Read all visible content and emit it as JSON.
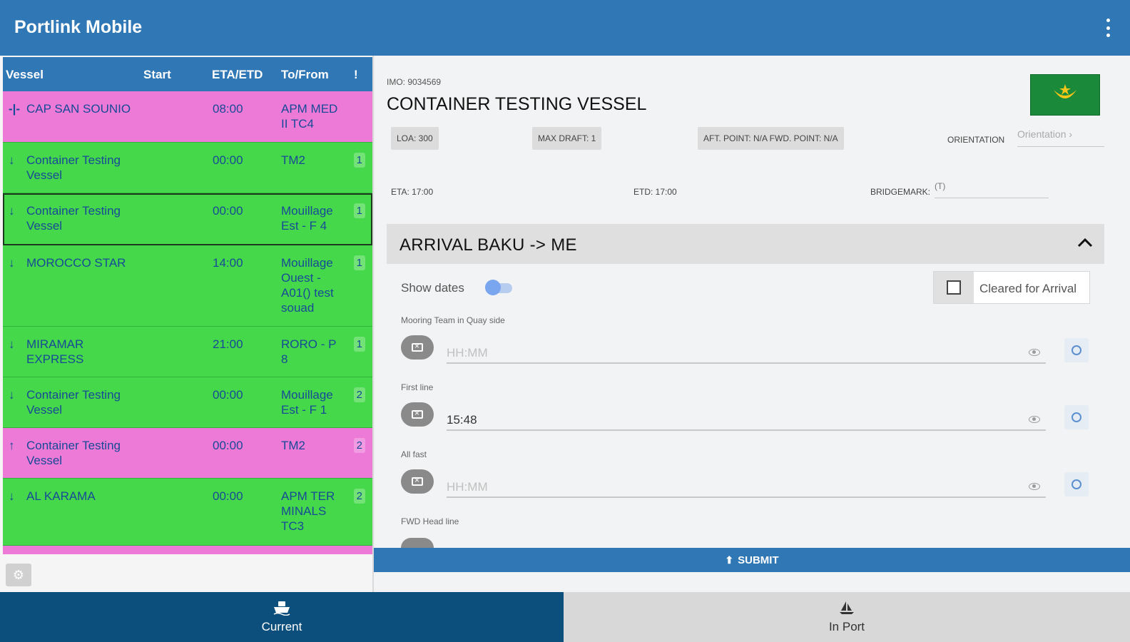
{
  "app": {
    "title": "Portlink Mobile"
  },
  "vessel_table": {
    "headers": {
      "vessel": "Vessel",
      "start": "Start",
      "eta_etd": "ETA/ETD",
      "to_from": "To/From",
      "flag": "!"
    },
    "rows": [
      {
        "icon": "-|-",
        "name": "CAP SAN SOUNIO",
        "start": "08:00",
        "dest": "APM MED\nII TC4",
        "badge": "",
        "color": "pink"
      },
      {
        "icon": "↓",
        "name": "Container Testing Vessel",
        "start": "00:00",
        "dest": "TM2",
        "badge": "1",
        "color": "green"
      },
      {
        "icon": "↓",
        "name": "Container Testing Vessel",
        "start": "00:00",
        "dest": "Mouillage Est - F 4",
        "badge": "1",
        "color": "green",
        "selected": true
      },
      {
        "icon": "↓",
        "name": "MOROCCO STAR",
        "start": "14:00",
        "dest": "Mouillage Ouest - A01() test souad",
        "badge": "1",
        "color": "green"
      },
      {
        "icon": "↓",
        "name": "MIRAMAR EXPRESS",
        "start": "21:00",
        "dest": "RORO - P 8",
        "badge": "1",
        "color": "green"
      },
      {
        "icon": "↓",
        "name": "Container Testing Vessel",
        "start": "00:00",
        "dest": "Mouillage Est - F 1",
        "badge": "2",
        "color": "green"
      },
      {
        "icon": "↑",
        "name": "Container Testing Vessel",
        "start": "00:00",
        "dest": "TM2",
        "badge": "2",
        "color": "pink"
      },
      {
        "icon": "↓",
        "name": "AL KARAMA",
        "start": "00:00",
        "dest": "APM TER MINALS TC3",
        "badge": "2",
        "color": "green"
      }
    ]
  },
  "detail": {
    "imo": "IMO: 9034569",
    "vessel_name": "CONTAINER TESTING VESSEL",
    "loa": "LOA: 300",
    "max_draft": "MAX DRAFT: 1",
    "points": "AFT. POINT: N/A   FWD. POINT: N/A",
    "orientation_label": "ORIENTATION",
    "orientation_placeholder": "Orientation ›",
    "eta": "ETA: 17:00",
    "etd": "ETD: 17:00",
    "bridgemark_label": "BRIDGEMARK:",
    "bridgemark_value": "(T)",
    "arrival_title": "ARRIVAL   BAKU -> ME",
    "show_dates_label": "Show dates",
    "cleared_label": "Cleared for Arrival",
    "fields": [
      {
        "label": "Mooring Team in Quay side",
        "value": "",
        "placeholder": "HH:MM"
      },
      {
        "label": "First line",
        "value": "15:48",
        "placeholder": "HH:MM"
      },
      {
        "label": "All fast",
        "value": "",
        "placeholder": "HH:MM"
      },
      {
        "label": "FWD Head line"
      }
    ],
    "submit_label": "SUBMIT"
  },
  "bottom_nav": {
    "current": "Current",
    "in_port": "In Port"
  },
  "colors": {
    "primary": "#2f77b5",
    "row_green": "#45d84a",
    "row_pink": "#ee7ad8",
    "nav_active": "#0d4f7c"
  }
}
